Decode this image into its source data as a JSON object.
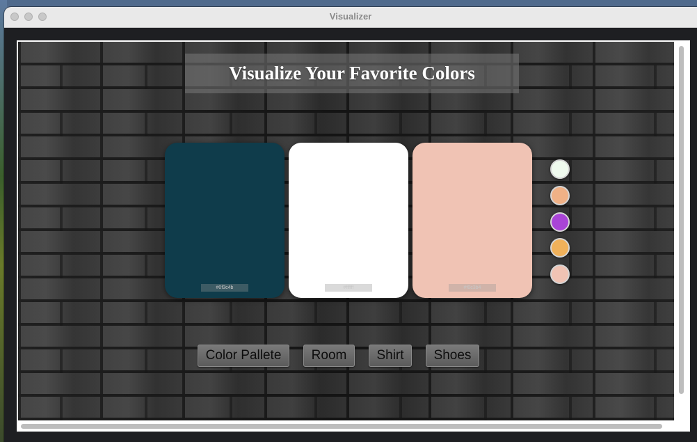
{
  "window": {
    "title": "Visualizer"
  },
  "heading": "Visualize Your Favorite Colors",
  "palette_cards": [
    {
      "color": "#0f3c4b",
      "label": "#0f3c4b"
    },
    {
      "color": "#ffffff",
      "label": "#ffffff"
    },
    {
      "color": "#f0c3b4",
      "label": "#f0c3b4"
    }
  ],
  "swatches": [
    {
      "color": "#effaee"
    },
    {
      "color": "#f0b186"
    },
    {
      "color": "#a944d6"
    },
    {
      "color": "#f0b15a"
    },
    {
      "color": "#f0c3b4"
    }
  ],
  "buttons": {
    "palette": "Color Pallete",
    "room": "Room",
    "shirt": "Shirt",
    "shoes": "Shoes"
  }
}
